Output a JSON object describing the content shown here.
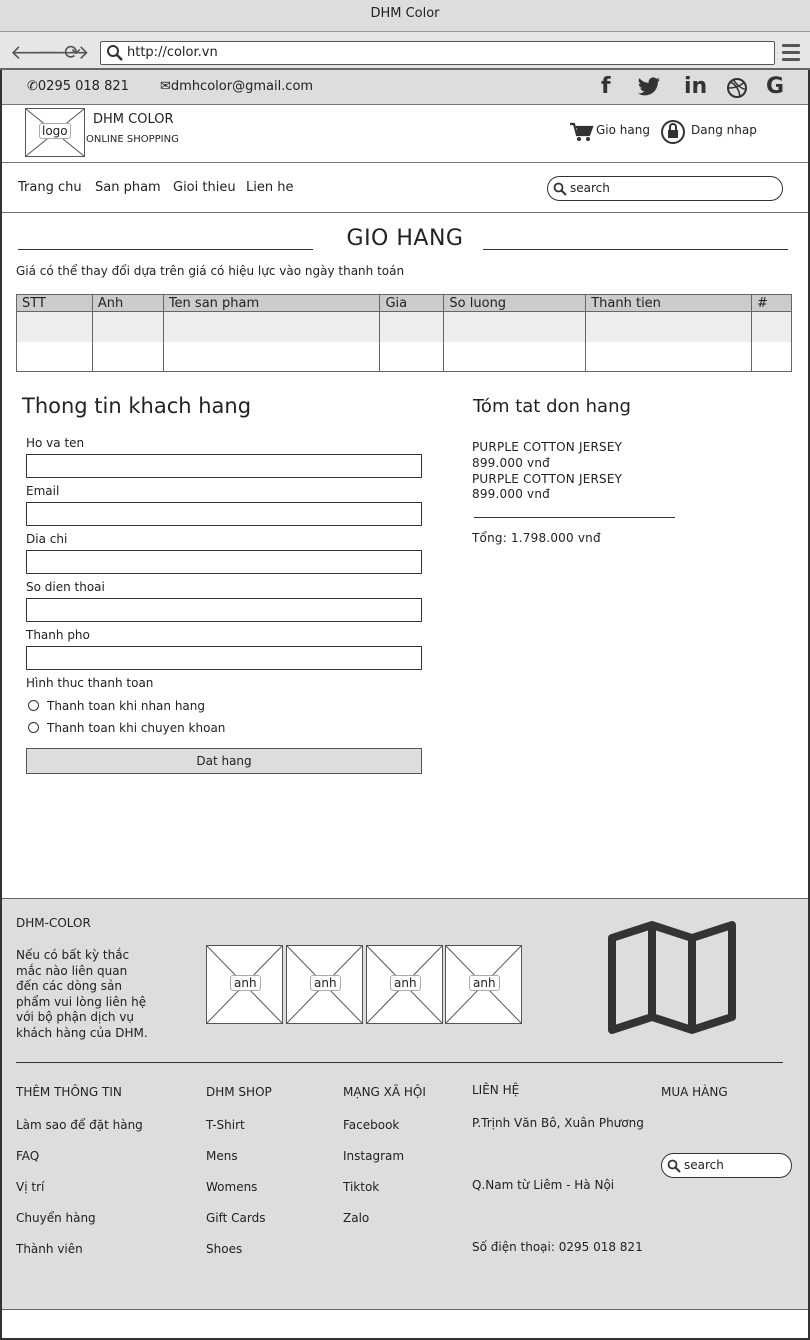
{
  "browser": {
    "title": "DHM Color",
    "url": "http://color.vn"
  },
  "contact": {
    "phone": "0295 018 821",
    "email": "dmhcolor@gmail.com",
    "social": [
      "f",
      "twitter",
      "in",
      "dribbble",
      "G"
    ]
  },
  "header": {
    "logo_label": "logo",
    "brand_name": "DHM COLOR",
    "tagline": "ONLINE SHOPPING",
    "cart_label": "Gio hang",
    "login_label": "Dang nhap"
  },
  "menu": {
    "items": [
      "Trang chu",
      "San pham",
      "Gioi thieu",
      "Lien he"
    ],
    "search_placeholder": "search"
  },
  "cart": {
    "title": "GIO HANG",
    "note": "Giá có thể thay đổi dựa trên giá có hiệu lực vào ngày thanh toán",
    "columns": [
      "STT",
      "Anh",
      "Ten san pham",
      "Gia",
      "So luong",
      "Thanh tien",
      "#"
    ]
  },
  "customer_form": {
    "title": "Thong tin khach hang",
    "fields": [
      "Ho va ten",
      "Email",
      "Dia chi",
      "So dien thoai",
      "Thanh pho"
    ],
    "payment_label": "Hình thuc thanh toan",
    "payment_options": [
      "Thanh toan khi nhan hang",
      "Thanh toan khi chuyen khoan"
    ],
    "submit_label": "Dat hang"
  },
  "summary": {
    "title": "Tóm tat don hang",
    "items": [
      {
        "name": "PURPLE COTTON JERSEY",
        "price": "899.000 vnđ"
      },
      {
        "name": "PURPLE COTTON JERSEY",
        "price": "899.000 vnđ"
      }
    ],
    "total": "Tổng: 1.798.000 vnđ"
  },
  "footer": {
    "brand": "DHM-COLOR",
    "about_lines": [
      "Nếu có bất kỳ thắc",
      "mắc nào liên quan",
      "đến các dòng sản",
      "phẩm vui lòng liên hệ",
      "với bộ phận dịch vụ",
      "khách hàng của DHM."
    ],
    "thumb_label": "anh",
    "columns": [
      {
        "heading": "THÊM THÔNG TIN",
        "links": [
          "Làm sao để đặt hàng",
          "FAQ",
          "Vị trí",
          "Chuyển hàng",
          "Thành viên"
        ]
      },
      {
        "heading": "DHM SHOP",
        "links": [
          "T-Shirt",
          "Mens",
          "Womens",
          "Gift Cards",
          "Shoes"
        ]
      },
      {
        "heading": "MẠNG XÃ HỘI",
        "links": [
          "Facebook",
          "Instagram",
          "Tiktok",
          "Zalo"
        ]
      }
    ],
    "contact_heading": "LIÊN HỆ",
    "contact_lines": [
      "P.Trịnh Văn Bô, Xuân Phương",
      "Q.Nam từ Liêm - Hà Nội",
      "Số điện thoại: 0295 018 821"
    ],
    "buy_heading": "MUA HÀNG",
    "search_placeholder": "search"
  }
}
